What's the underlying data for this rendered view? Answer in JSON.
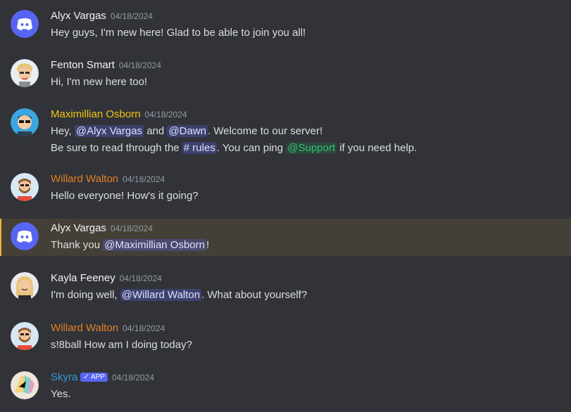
{
  "messages": [
    {
      "author": "Alyx Vargas",
      "time": "04/18/2024",
      "lines": [
        "Hey guys, I'm new here! Glad to be able to join you all!"
      ]
    },
    {
      "author": "Fenton Smart",
      "time": "04/18/2024",
      "lines": [
        "Hi, I'm new here too!"
      ]
    },
    {
      "author": "Maximillian Osborn",
      "time": "04/18/2024",
      "line1": {
        "a": "Hey, ",
        "m1": "@Alyx Vargas",
        "b": " and ",
        "m2": "@Dawn",
        "c": ". Welcome to our server!"
      },
      "line2": {
        "a": "Be sure to read through the ",
        "channel": "# rules",
        "b": ". You can ping ",
        "role": "@Support",
        "c": " if you need help."
      }
    },
    {
      "author": "Willard Walton",
      "time": "04/18/2024",
      "lines": [
        "Hello everyone! How's it going?"
      ]
    },
    {
      "author": "Alyx Vargas",
      "time": "04/18/2024",
      "line": {
        "a": "Thank you ",
        "m": "@Maximillian Osborn",
        "b": "!"
      }
    },
    {
      "author": "Kayla Feeney",
      "time": "04/18/2024",
      "line": {
        "a": "I'm doing well, ",
        "m": "@Willard Walton",
        "b": ". What about yourself?"
      }
    },
    {
      "author": "Willard Walton",
      "time": "04/18/2024",
      "lines": [
        "s!8ball How am I doing today?"
      ]
    },
    {
      "author": "Skyra",
      "badge": "✓ APP",
      "time": "04/18/2024",
      "lines": [
        "Yes."
      ]
    }
  ],
  "colors": {
    "background": "#313338",
    "highlight": "#444037",
    "maximillian": "#f1c40f",
    "willard": "#e67e22",
    "skyra": "#3498db",
    "blurple": "#5865f2"
  }
}
